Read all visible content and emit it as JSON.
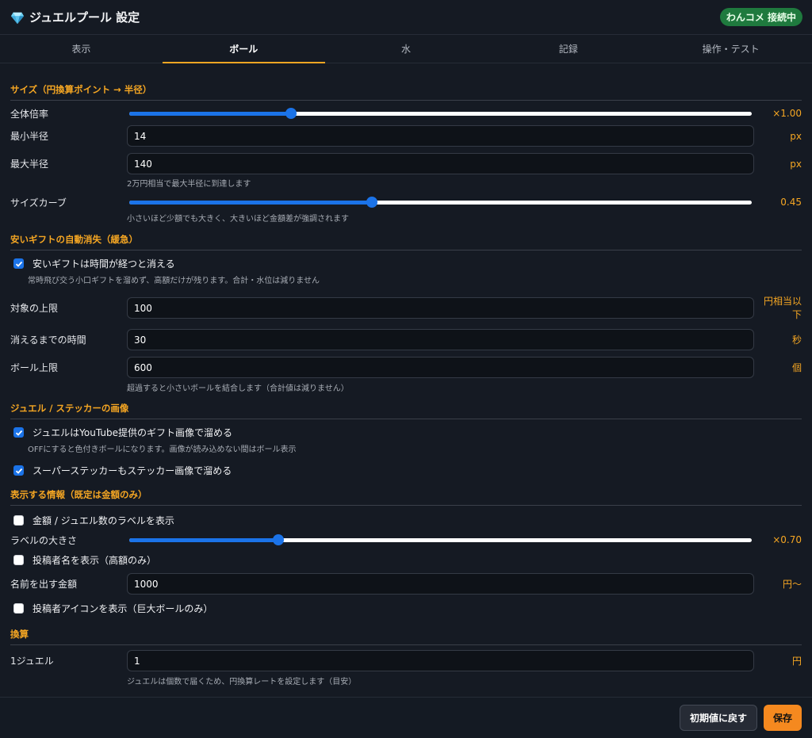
{
  "header": {
    "title": "ジュエルプール 設定",
    "icon": "gem-icon",
    "status": "わんコメ 接続中"
  },
  "tabs": [
    {
      "label": "表示",
      "active": false
    },
    {
      "label": "ボール",
      "active": true
    },
    {
      "label": "水",
      "active": false
    },
    {
      "label": "記録",
      "active": false
    },
    {
      "label": "操作・テスト",
      "active": false
    }
  ],
  "size": {
    "title": "サイズ（円換算ポイント → 半径）",
    "scale_label": "全体倍率",
    "scale_value": "×1.00",
    "scale_fraction": 0.26,
    "min_label": "最小半径",
    "min_value": "14",
    "min_unit": "px",
    "max_label": "最大半径",
    "max_value": "140",
    "max_unit": "px",
    "max_hint": "2万円相当で最大半径に到達します",
    "curve_label": "サイズカーブ",
    "curve_value": "0.45",
    "curve_fraction": 0.39,
    "curve_hint": "小さいほど少額でも大きく、大きいほど金額差が強調されます"
  },
  "fade": {
    "title": "安いギフトの自動消失（緩急）",
    "enable_label": "安いギフトは時間が経つと消える",
    "enable_checked": true,
    "enable_hint": "常時飛び交う小口ギフトを溜めず、高額だけが残ります。合計・水位は減りません",
    "limit_label": "対象の上限",
    "limit_value": "100",
    "limit_unit": "円相当以下",
    "time_label": "消えるまでの時間",
    "time_value": "30",
    "time_unit": "秒",
    "ball_label": "ボール上限",
    "ball_value": "600",
    "ball_unit": "個",
    "ball_hint": "超過すると小さいボールを結合します（合計値は減りません）"
  },
  "images": {
    "title": "ジュエル / ステッカーの画像",
    "jewel_label": "ジュエルはYouTube提供のギフト画像で溜める",
    "jewel_checked": true,
    "jewel_hint": "OFFにすると色付きボールになります。画像が読み込めない間はボール表示",
    "sticker_label": "スーパーステッカーもステッカー画像で溜める",
    "sticker_checked": true
  },
  "info": {
    "title": "表示する情報（既定は金額のみ）",
    "amount_label": "金額 / ジュエル数のラベルを表示",
    "amount_checked": false,
    "labelsize_label": "ラベルの大きさ",
    "labelsize_value": "×0.70",
    "labelsize_fraction": 0.24,
    "name_label": "投稿者名を表示（高額のみ）",
    "name_checked": false,
    "nameamount_label": "名前を出す金額",
    "nameamount_value": "1000",
    "nameamount_unit": "円〜",
    "icon_label": "投稿者アイコンを表示（巨大ボールのみ）",
    "icon_checked": false
  },
  "conversion": {
    "title": "換算",
    "jewel_label": "1ジュエル",
    "jewel_value": "1",
    "jewel_unit": "円",
    "jewel_hint": "ジュエルは個数で届くため、円換算レートを設定します（目安）"
  },
  "footer": {
    "reset_label": "初期値に戻す",
    "save_label": "保存"
  }
}
